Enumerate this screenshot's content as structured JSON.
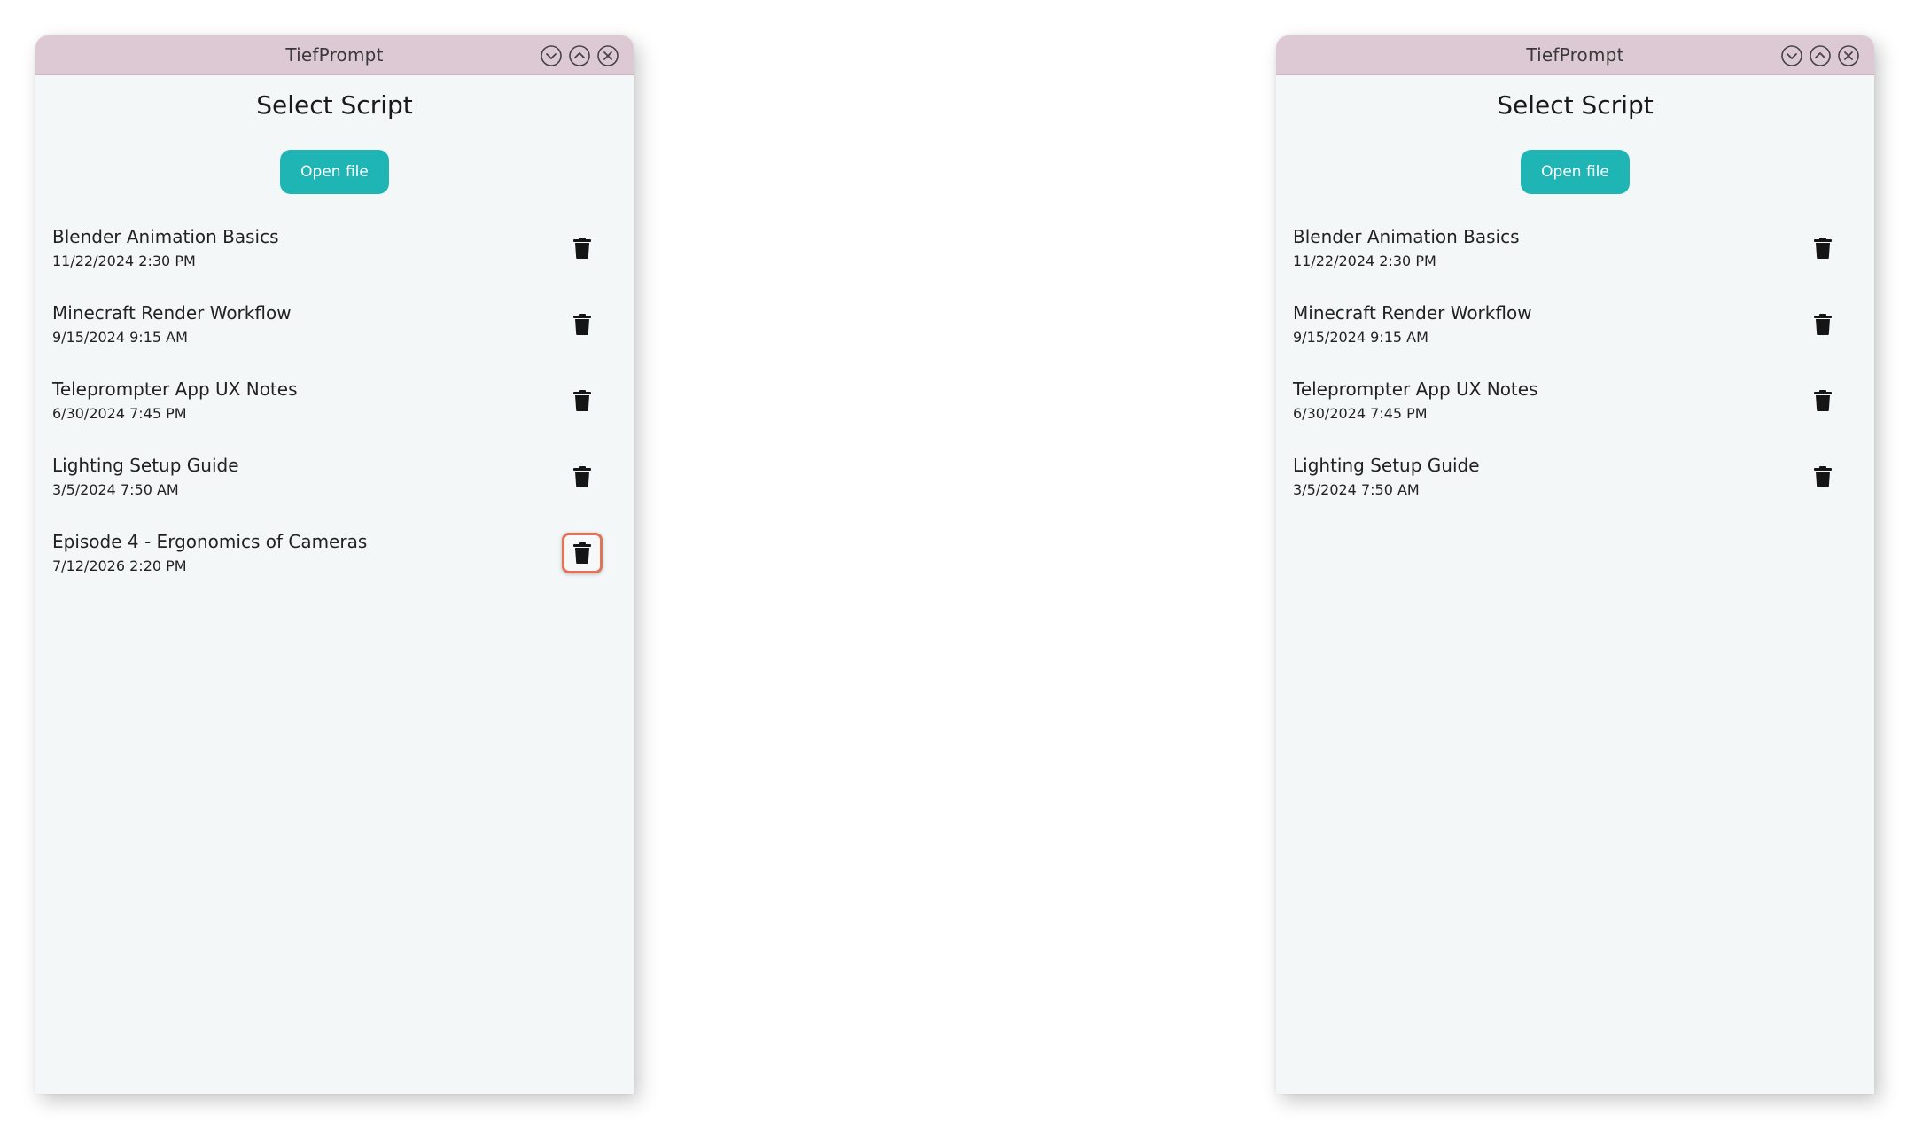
{
  "windows": [
    {
      "title": "TiefPrompt",
      "heading": "Select Script",
      "open_label": "Open file",
      "scripts": [
        {
          "name": "Blender Animation Basics",
          "date": "11/22/2024 2:30 PM"
        },
        {
          "name": "Minecraft Render Workflow",
          "date": "9/15/2024 9:15 AM"
        },
        {
          "name": "Teleprompter App UX Notes",
          "date": "6/30/2024 7:45 PM"
        },
        {
          "name": "Lighting Setup Guide",
          "date": "3/5/2024 7:50 AM"
        },
        {
          "name": "Episode 4 - Ergonomics of Cameras",
          "date": "7/12/2026 2:20 PM",
          "highlighted": true
        }
      ]
    },
    {
      "title": "TiefPrompt",
      "heading": "Select Script",
      "open_label": "Open file",
      "scripts": [
        {
          "name": "Blender Animation Basics",
          "date": "11/22/2024 2:30 PM"
        },
        {
          "name": "Minecraft Render Workflow",
          "date": "9/15/2024 9:15 AM"
        },
        {
          "name": "Teleprompter App UX Notes",
          "date": "6/30/2024 7:45 PM"
        },
        {
          "name": "Lighting Setup Guide",
          "date": "3/5/2024 7:50 AM"
        }
      ]
    }
  ],
  "icons": {
    "minimize": "chevron-down-icon",
    "maximize": "chevron-up-icon",
    "close": "close-icon",
    "delete": "trash-icon"
  },
  "colors": {
    "titlebar": "#ddc9d3",
    "accent": "#1fb5b5",
    "highlight": "#e0735a",
    "window_bg": "#f3f7f8"
  }
}
